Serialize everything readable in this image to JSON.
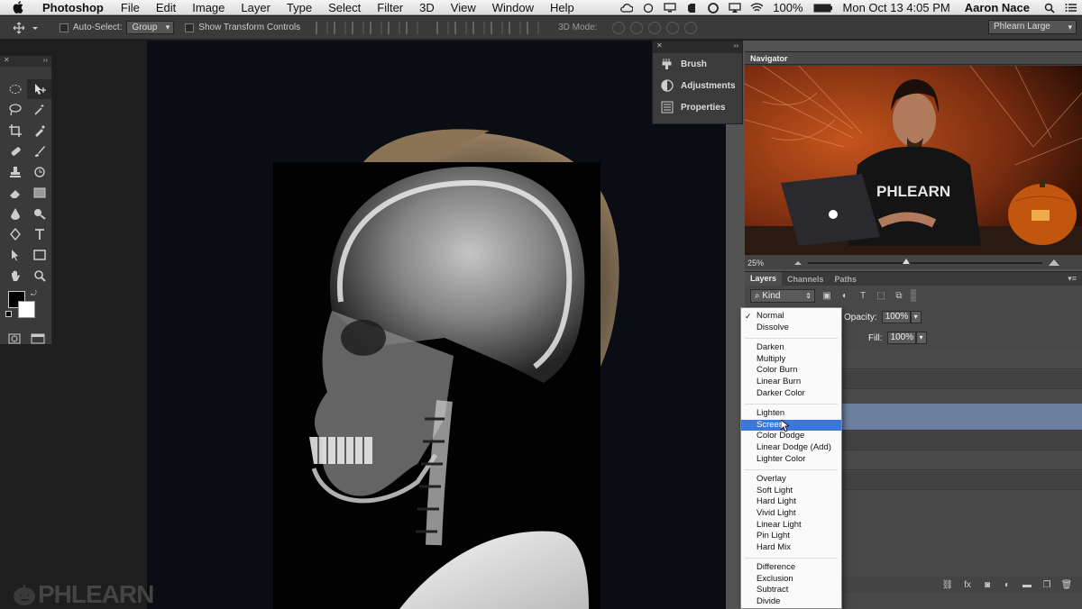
{
  "menubar": {
    "app": "Photoshop",
    "items": [
      "File",
      "Edit",
      "Image",
      "Layer",
      "Type",
      "Select",
      "Filter",
      "3D",
      "View",
      "Window",
      "Help"
    ],
    "battery": "100%",
    "clock": "Mon Oct 13  4:05 PM",
    "user": "Aaron Nace"
  },
  "options": {
    "auto_select_label": "Auto-Select:",
    "auto_select_value": "Group",
    "transform_label": "Show Transform Controls",
    "mode_label": "3D Mode:",
    "workspace": "Phlearn Large"
  },
  "panels": {
    "brush": "Brush",
    "adjustments": "Adjustments",
    "properties": "Properties"
  },
  "navigator": {
    "title": "Navigator",
    "zoom": "25%",
    "zoom_level": 0.42
  },
  "layers": {
    "tabs": [
      "Layers",
      "Channels",
      "Paths"
    ],
    "kind": "Kind",
    "opacity_label": "Opacity:",
    "opacity_value": "100%",
    "fill_label": "Fill:",
    "fill_value": "100%"
  },
  "blend_menu": {
    "groups": [
      [
        "Normal",
        "Dissolve"
      ],
      [
        "Darken",
        "Multiply",
        "Color Burn",
        "Linear Burn",
        "Darker Color"
      ],
      [
        "Lighten",
        "Screen",
        "Color Dodge",
        "Linear Dodge (Add)",
        "Lighter Color"
      ],
      [
        "Overlay",
        "Soft Light",
        "Hard Light",
        "Vivid Light",
        "Linear Light",
        "Pin Light",
        "Hard Mix"
      ],
      [
        "Difference",
        "Exclusion",
        "Subtract",
        "Divide"
      ]
    ],
    "checked": "Normal",
    "highlighted": "Screen"
  },
  "watermark": "PHLEARN",
  "colors": {
    "highlight": "#3b76d8",
    "selected_layer": "#6d7fa0"
  }
}
